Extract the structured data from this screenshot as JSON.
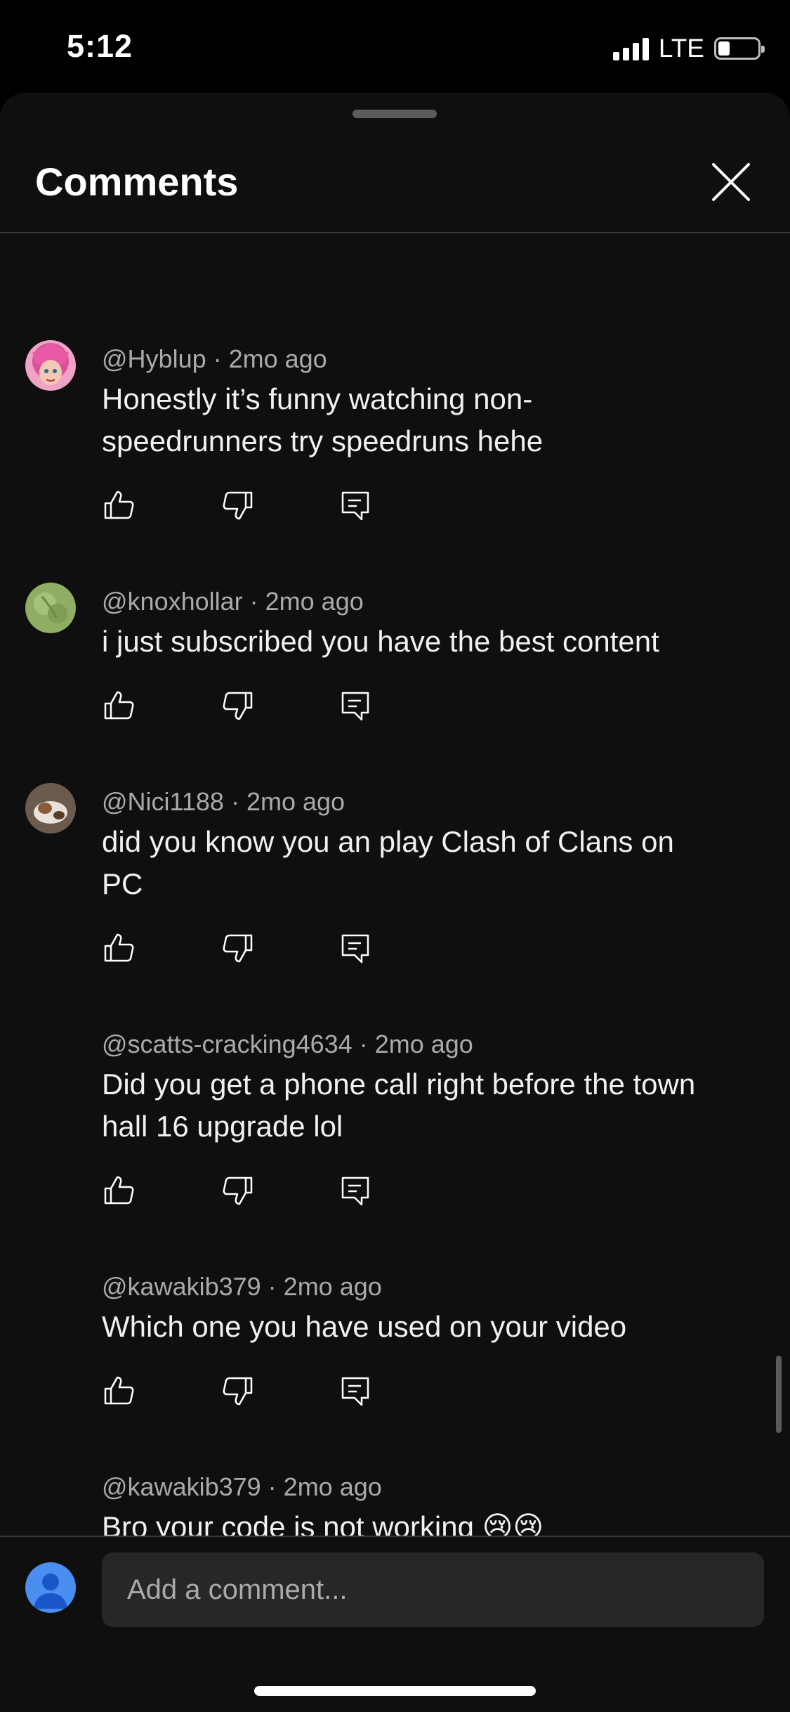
{
  "status_bar": {
    "time": "5:12",
    "network": "LTE",
    "battery_level": 0.2,
    "signal_bars": 4
  },
  "header": {
    "title": "Comments",
    "close_icon": "close-icon"
  },
  "comments": [
    {
      "author": "@Hyblup",
      "time": "2mo ago",
      "text": "Honestly it’s funny watching non-speedrunners try speedruns hehe",
      "avatar": "anime-avatar",
      "avatar_color": "#d9539c"
    },
    {
      "author": "@knoxhollar",
      "time": "2mo ago",
      "text": "i just subscribed you have the best content",
      "avatar": "green-avatar",
      "avatar_color": "#8fae63"
    },
    {
      "author": "@Nici1188",
      "time": "2mo ago",
      "text": "did you know you an play Clash of Clans on PC",
      "avatar": "photo-avatar",
      "avatar_color": "#6b5a4e"
    },
    {
      "author": "@scatts-cracking4634",
      "time": "2mo ago",
      "text": "Did you get a phone call right before the town hall 16 upgrade lol",
      "avatar": null
    },
    {
      "author": "@kawakib379",
      "time": "2mo ago",
      "text": "Which one you have used on your video",
      "avatar": null
    },
    {
      "author": "@kawakib379",
      "time": "2mo ago",
      "text": "Bro your code  is not working 😢😢",
      "avatar": null
    }
  ],
  "actions": {
    "like_icon": "thumbs-up-icon",
    "dislike_icon": "thumbs-down-icon",
    "reply_icon": "reply-icon"
  },
  "footer": {
    "placeholder": "Add a comment...",
    "user_avatar": "default-user-avatar"
  },
  "colors": {
    "background": "#0f0f0f",
    "input_background": "#272727",
    "meta_text": "#aaaaaa",
    "user_avatar": "#4a8ff0"
  }
}
